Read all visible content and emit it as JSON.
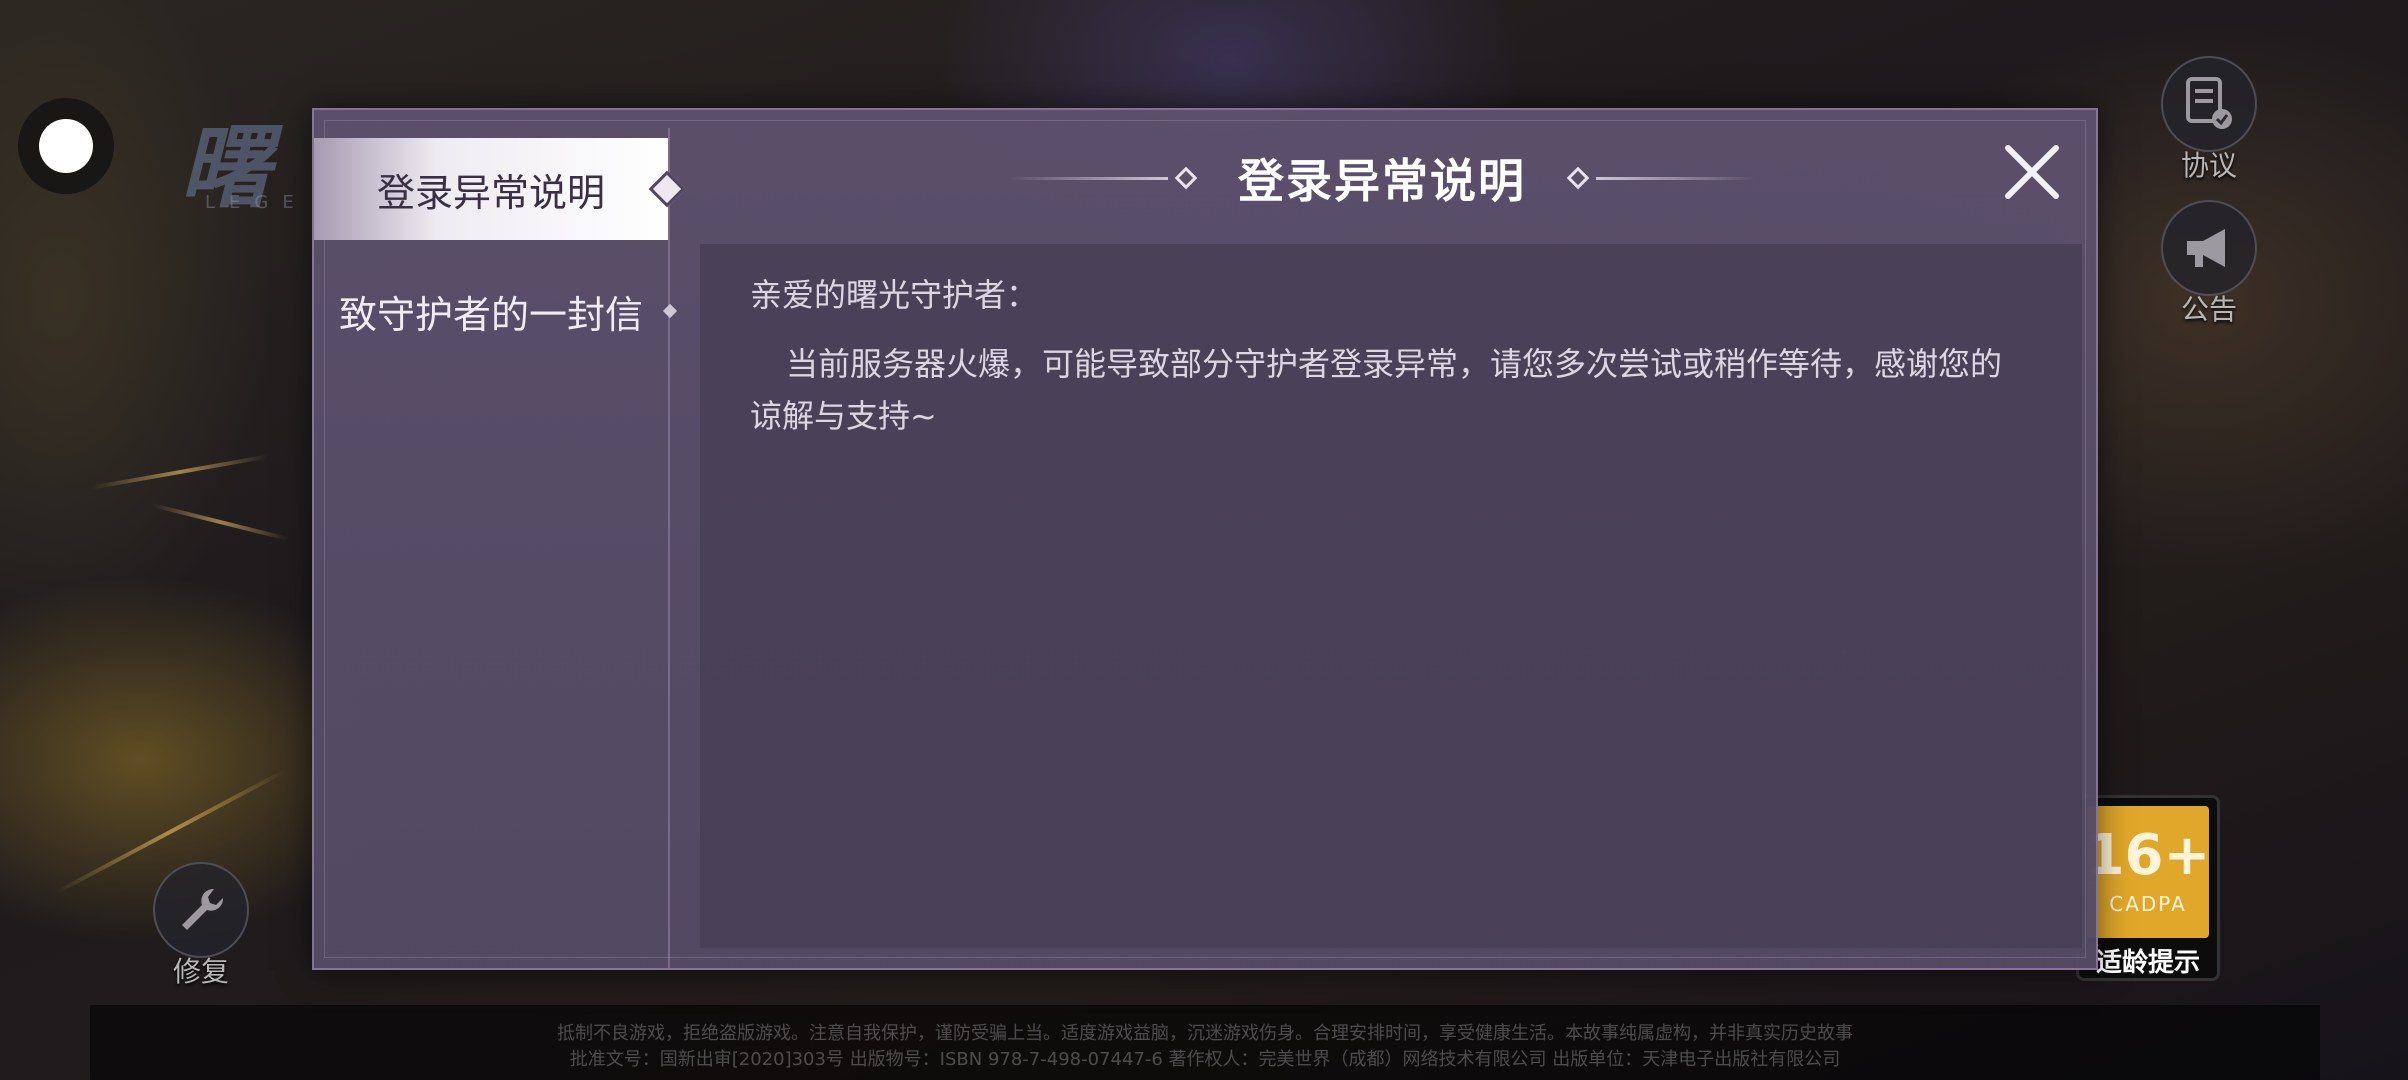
{
  "background": {
    "logo_text": "曙",
    "logo_sub": "LEGE"
  },
  "side_buttons": {
    "agreement_label": "协议",
    "announcement_label": "公告",
    "repair_label": "修复"
  },
  "age_rating": {
    "number": "16+",
    "org": "CADPA",
    "label": "适龄提示"
  },
  "footer": {
    "line1": "抵制不良游戏，拒绝盗版游戏。注意自我保护，谨防受骗上当。适度游戏益脑，沉迷游戏伤身。合理安排时间，享受健康生活。本故事纯属虚构，并非真实历史故事",
    "line2": "批准文号：国新出审[2020]303号  出版物号：ISBN 978-7-498-07447-6  著作权人：完美世界（成都）网络技术有限公司  出版单位：天津电子出版社有限公司"
  },
  "dialog": {
    "title": "登录异常说明",
    "tabs": [
      {
        "label": "登录异常说明",
        "active": true
      },
      {
        "label": "致守护者的一封信",
        "active": false
      }
    ],
    "greeting": "亲爱的曙光守护者：",
    "body": "当前服务器火爆，可能导致部分守护者登录异常，请您多次尝试或稍作等待，感谢您的谅解与支持~"
  },
  "colors": {
    "dialog_bg": "#5c506c",
    "content_bg": "#463e54",
    "active_tab_text": "#3a2f45",
    "age_badge": "#e0a72a"
  }
}
